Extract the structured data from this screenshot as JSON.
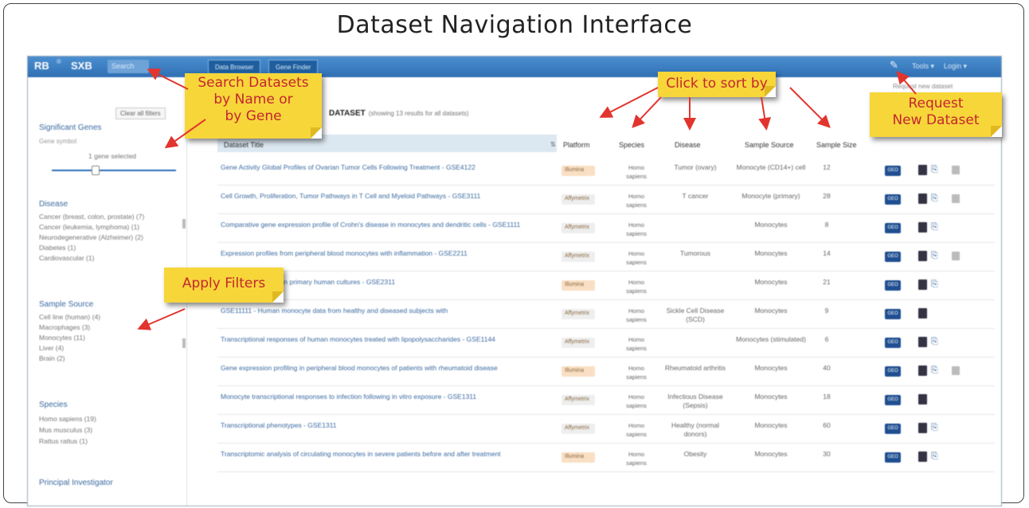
{
  "figure_title": "Dataset Navigation Interface",
  "topbar": {
    "brand": "RB",
    "brand_mark": "®",
    "brand2": "SXB",
    "search_placeholder": "Search",
    "buttons": [
      "Data Browser",
      "Gene Finder"
    ],
    "links": [
      "Tools ▾",
      "Login ▾"
    ]
  },
  "annotations": {
    "search": "Search Datasets\nby Name or\nby Gene",
    "sort": "Click to sort by",
    "request": "Request\nNew Dataset",
    "filters": "Apply Filters"
  },
  "sidebar": {
    "clear_button": "Clear all filters",
    "sections": [
      {
        "head": "Significant Genes",
        "sub": "Gene symbol",
        "slider_label": "1 gene selected"
      },
      {
        "head": "Disease",
        "items": [
          "Cancer (breast, colon, prostate) (7)",
          "Cancer (leukemia, lymphoma) (1)",
          "Neurodegenerative (Alzheimer) (2)",
          "Diabetes (1)",
          "Cardiovascular (1)"
        ]
      },
      {
        "head": "Sample Source",
        "items": [
          "Cell line (human) (4)",
          "Macrophages (3)",
          "Monocytes (11)",
          "Liver (4)",
          "Brain (2)"
        ]
      },
      {
        "head": "Species",
        "items": [
          "Homo sapiens (19)",
          "Mus musculus (3)",
          "Rattus rattus (1)"
        ]
      },
      {
        "head": "Principal Investigator"
      }
    ]
  },
  "main": {
    "title_bold": "DATASET",
    "title_rest": "(showing 13 results for all datasets)",
    "right_hint": "Request new dataset",
    "columns": [
      "Dataset Title",
      "Platform",
      "Species",
      "Disease",
      "Sample Source",
      "Sample Size"
    ],
    "sort_indicator": "⇅",
    "download_label": "GEO"
  },
  "rows": [
    {
      "title": "Gene Activity Global Profiles of Ovarian Tumor Cells Following Treatment - GSE4122",
      "platform": "Illumina",
      "species": "Homo sapiens",
      "disease": "Tumor (ovary)",
      "source": "Monocyte (CD14+) cell",
      "n": "12",
      "extra": true
    },
    {
      "title": "Cell Growth, Proliferation, Tumor Pathways in T Cell and Myeloid Pathways - GSE3111",
      "platform": "Affymetrix",
      "species": "Homo sapiens",
      "disease": "T cancer",
      "source": "Monocyte (primary)",
      "n": "28",
      "extra": true
    },
    {
      "title": "Comparative gene expression profile of Crohn's disease in monocytes and dendritic cells - GSE1111",
      "platform": "Affymetrix",
      "species": "Homo sapiens",
      "disease": "",
      "source": "Monocytes",
      "n": "8",
      "extra": false
    },
    {
      "title": "Expression profiles from peripheral blood monocytes with inflammation - GSE2211",
      "platform": "Affymetrix",
      "species": "Homo sapiens",
      "disease": "Tumorous",
      "source": "Monocytes",
      "n": "14",
      "extra": true
    },
    {
      "title": "Monocyte activation in primary human cultures - GSE2311",
      "platform": "Illumina",
      "species": "Homo sapiens",
      "disease": "",
      "source": "Monocytes",
      "n": "21",
      "extra": false
    },
    {
      "title": "GSE11111 - Human monocyte data from healthy and diseased subjects with",
      "platform": "Affymetrix",
      "species": "Homo sapiens",
      "disease": "Sickle Cell Disease (SCD)",
      "source": "Monocytes",
      "n": "9",
      "extra": false
    },
    {
      "title": "Transcriptional responses of human monocytes treated with lipopolysaccharides - GSE1144",
      "platform": "Affymetrix",
      "species": "Homo sapiens",
      "disease": "",
      "source": "Monocytes (stimulated)",
      "n": "6",
      "extra": false
    },
    {
      "title": "Gene expression profiling in peripheral blood monocytes of patients with rheumatoid disease",
      "platform": "Illumina",
      "species": "Homo sapiens",
      "disease": "Rheumatoid arthritis",
      "source": "Monocytes",
      "n": "40",
      "extra": true
    },
    {
      "title": "Monocyte transcriptional responses to infection following in vitro exposure - GSE1311",
      "platform": "Affymetrix",
      "species": "Homo sapiens",
      "disease": "Infectious Disease (Sepsis)",
      "source": "Monocytes",
      "n": "18",
      "extra": false
    },
    {
      "title": "Transcriptional phenotypes - GSE1311",
      "platform": "Affymetrix",
      "species": "Homo sapiens",
      "disease": "Healthy (normal donors)",
      "source": "Monocytes",
      "n": "60",
      "extra": false
    },
    {
      "title": "Transcriptomic analysis of circulating monocytes in severe patients before and after treatment",
      "platform": "Illumina",
      "species": "Homo sapiens",
      "disease": "Obesity",
      "source": "Monocytes",
      "n": "30",
      "extra": false
    }
  ]
}
